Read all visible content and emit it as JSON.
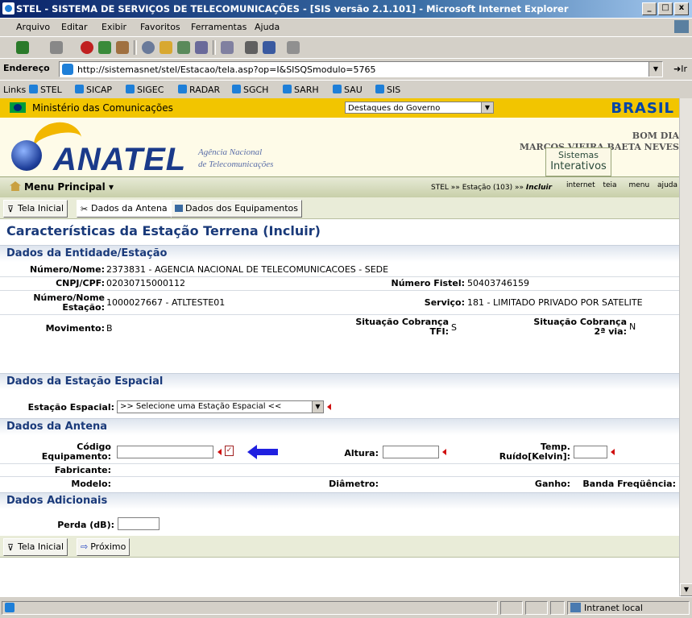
{
  "window": {
    "title": "STEL - SISTEMA DE SERVIÇOS DE TELECOMUNICAÇÕES - [SIS versão 2.1.101] - Microsoft Internet Explorer",
    "min": "_",
    "max": "□",
    "close": "x"
  },
  "menu": [
    "Arquivo",
    "Editar",
    "Exibir",
    "Favoritos",
    "Ferramentas",
    "Ajuda"
  ],
  "address": {
    "label": "Endereço",
    "url": "http://sistemasnet/stel/Estacao/tela.asp?op=I&SISQSmodulo=5765",
    "go": "Ir"
  },
  "links": {
    "label": "Links",
    "items": [
      "STEL",
      "SICAP",
      "SIGEC",
      "RADAR",
      "SGCH",
      "SARH",
      "SAU",
      "SIS"
    ]
  },
  "gov": {
    "ministerio": "Ministério das Comunicações",
    "destaques": "Destaques do Governo",
    "brasil": "BRASIL"
  },
  "header": {
    "logo": "ANATEL",
    "agencia1": "Agência Nacional",
    "agencia2": "de Telecomunicações",
    "bomdia": "BOM DIA",
    "user": "MARCOS VIEIRA BAETA NEVES",
    "sistemas": "Sistemas",
    "interativos": "Interativos"
  },
  "nav": {
    "menu_principal": "Menu Principal",
    "crumb_1": "STEL",
    "crumb_2": "Estação (103)",
    "crumb_3": "Incluir",
    "internet": "internet",
    "teia": "teia",
    "menu": "menu",
    "ajuda": "ajuda"
  },
  "tabs": {
    "tela_inicial": "Tela Inicial",
    "dados_antena": "Dados da Antena",
    "dados_equip": "Dados dos Equipamentos"
  },
  "page": {
    "title": "Características da Estação Terrena (Incluir)"
  },
  "entidade": {
    "section": "Dados da Entidade/Estação",
    "numero_nome_lbl": "Número/Nome:",
    "numero_nome": "2373831 - AGENCIA NACIONAL DE TELECOMUNICACOES - SEDE",
    "cnpj_lbl": "CNPJ/CPF:",
    "cnpj": "02030715000112",
    "fistel_lbl": "Número Fistel:",
    "fistel": "50403746159",
    "estacao_lbl1": "Número/Nome",
    "estacao_lbl2": "Estação:",
    "estacao": "1000027667 - ATLTESTE01",
    "servico_lbl": "Serviço:",
    "servico": "181 - LIMITADO PRIVADO POR SATELITE",
    "movimento_lbl": "Movimento:",
    "movimento": "B",
    "sit_tfi_lbl1": "Situação Cobrança",
    "sit_tfi_lbl2": "TFI:",
    "sit_tfi": "S",
    "sit_2via_lbl1": "Situação Cobrança",
    "sit_2via_lbl2": "2ª via:",
    "sit_2via": "N"
  },
  "espacial": {
    "section": "Dados da Estação Espacial",
    "label": "Estação Espacial:",
    "selected": ">> Selecione uma Estação Espacial <<"
  },
  "antena": {
    "section": "Dados da Antena",
    "codigo_lbl1": "Código",
    "codigo_lbl2": "Equipamento:",
    "altura_lbl": "Altura:",
    "temp_lbl1": "Temp.",
    "temp_lbl2": "Ruído[Kelvin]:",
    "fabricante_lbl": "Fabricante:",
    "modelo_lbl": "Modelo:",
    "diametro_lbl": "Diâmetro:",
    "ganho_lbl": "Ganho:",
    "banda_lbl": "Banda Freqüência:"
  },
  "adicionais": {
    "section": "Dados Adicionais",
    "perda_lbl": "Perda (dB):"
  },
  "bottom": {
    "tela_inicial": "Tela Inicial",
    "proximo": "Próximo"
  },
  "status": {
    "zone": "Intranet local"
  }
}
